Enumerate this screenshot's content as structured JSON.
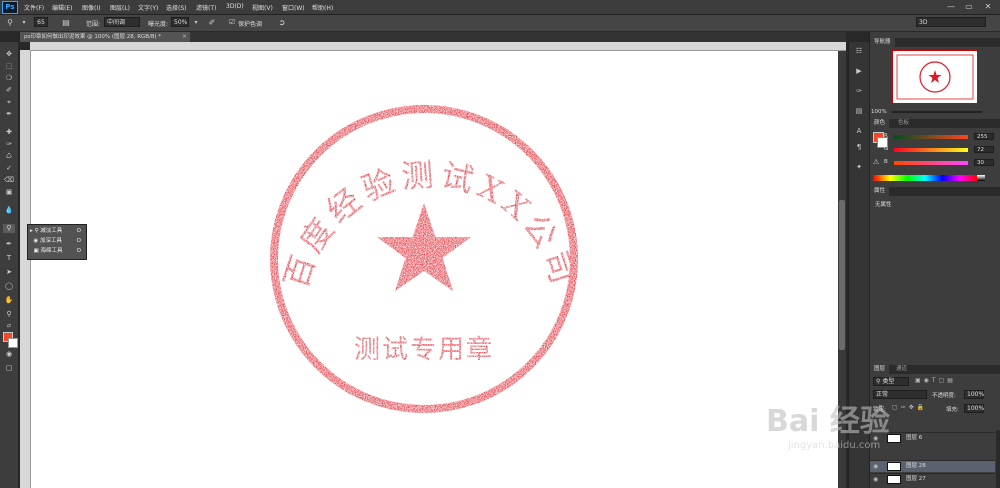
{
  "app": {
    "logo": "Ps",
    "menu": [
      "文件(F)",
      "编辑(E)",
      "图像(I)",
      "图层(L)",
      "文字(Y)",
      "选择(S)",
      "滤镜(T)",
      "3D(D)",
      "视图(V)",
      "窗口(W)",
      "帮助(H)"
    ],
    "window_controls": [
      "—",
      "▭",
      "✕"
    ],
    "workspace": "3D"
  },
  "options": {
    "brush_size": "65",
    "range_label": "范围:",
    "range_value": "中间调",
    "exposure_label": "曝光度:",
    "exposure_value": "50%",
    "protect_tones": "保护色调"
  },
  "document": {
    "tab_title": "ps印章如何做出印泥效果 @ 100% (图层 28, RGB/8) *",
    "close": "×"
  },
  "tool_flyout": [
    {
      "label": "减淡工具",
      "key": "O"
    },
    {
      "label": "加深工具",
      "key": "O"
    },
    {
      "label": "海绵工具",
      "key": "O"
    }
  ],
  "stamp": {
    "color": "#e01823",
    "arc_text": "百度经验测试XX公司",
    "bottom_text": "测试专用章"
  },
  "navigator": {
    "tab": "导航器",
    "zoom": "100%"
  },
  "color_panel": {
    "tabs": [
      "颜色",
      "色板"
    ],
    "foreground": "#f5462a",
    "r": {
      "label": "R",
      "value": "255",
      "fraction": 1.0
    },
    "g": {
      "label": "G",
      "value": "72",
      "fraction": 0.282
    },
    "b": {
      "label": "B",
      "value": "30",
      "fraction": 0.118
    }
  },
  "properties": {
    "tab": "属性",
    "content": "无属性"
  },
  "layers": {
    "tabs": [
      "图层",
      "通道"
    ],
    "filter": "类型",
    "blend_mode": "正常",
    "opacity_label": "不透明度:",
    "opacity_value": "100%",
    "lock_label": "锁定:",
    "fill_label": "填充:",
    "fill_value": "100%",
    "rows": [
      {
        "name": "图层 6"
      },
      {
        "name": "图层 28"
      },
      {
        "name": "图层 27"
      }
    ]
  },
  "watermark": {
    "text": "Bai 经验",
    "url": "jingyan.baidu.com"
  }
}
